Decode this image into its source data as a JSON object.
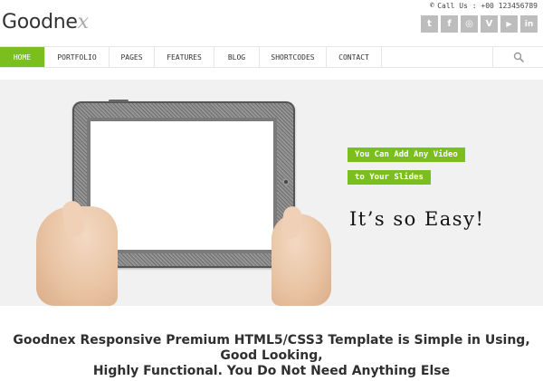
{
  "brand": {
    "logo_text": "Goodne",
    "logo_mark": "x"
  },
  "contact": {
    "label": "Call Us : +00 123456789"
  },
  "socials": [
    {
      "icon": "twitter-icon",
      "glyph": "t"
    },
    {
      "icon": "facebook-icon",
      "glyph": "f"
    },
    {
      "icon": "dribbble-icon",
      "glyph": "◎"
    },
    {
      "icon": "vimeo-icon",
      "glyph": "V"
    },
    {
      "icon": "youtube-icon",
      "glyph": "▶"
    },
    {
      "icon": "linkedin-icon",
      "glyph": "in"
    }
  ],
  "nav": {
    "items": [
      "Home",
      "Portfolio",
      "Pages",
      "Features",
      "Blog",
      "Shortcodes",
      "Contact"
    ],
    "active_index": 0
  },
  "slider": {
    "caption1": "You Can Add Any Video",
    "caption2": "to Your Slides",
    "tagline": "It’s so Easy!"
  },
  "headline": {
    "line1": "Goodnex Responsive Premium HTML5/CSS3 Template is Simple in Using, Good Looking,",
    "line2": "Highly Functional. You Do Not Need Anything Else"
  },
  "colors": {
    "accent": "#7bbf1f",
    "social_bg": "#bdbdbd",
    "slider_bg": "#f1f1f1"
  }
}
